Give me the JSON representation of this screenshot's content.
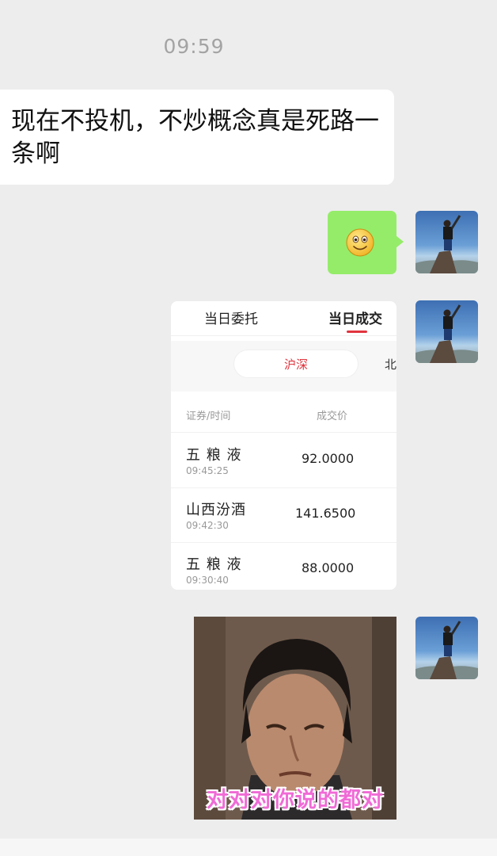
{
  "chat": {
    "timestamp": "09:59",
    "incoming_message": "现在不投机，不炒概念真是死路一条啊"
  },
  "trade_card": {
    "tabs": [
      "当日委托",
      "当日成交"
    ],
    "active_tab": "当日成交",
    "segments": [
      "沪深",
      "北"
    ],
    "active_segment": "沪深",
    "columns": [
      "证券/时间",
      "成交价"
    ],
    "rows": [
      {
        "name": "五 粮 液",
        "time": "09:45:25",
        "price": "92.0000"
      },
      {
        "name": "山西汾酒",
        "time": "09:42:30",
        "price": "141.6500"
      },
      {
        "name": "五 粮 液",
        "time": "09:30:40",
        "price": "88.0000"
      }
    ]
  },
  "sticker": {
    "caption": "对对对你说的都对"
  },
  "colors": {
    "background": "#ededed",
    "outgoing_bubble": "#95ec69",
    "accent_red": "#e0343e",
    "sticker_caption": "#f06bd6"
  },
  "icons": {
    "emoji": "smiling-face-icon"
  }
}
